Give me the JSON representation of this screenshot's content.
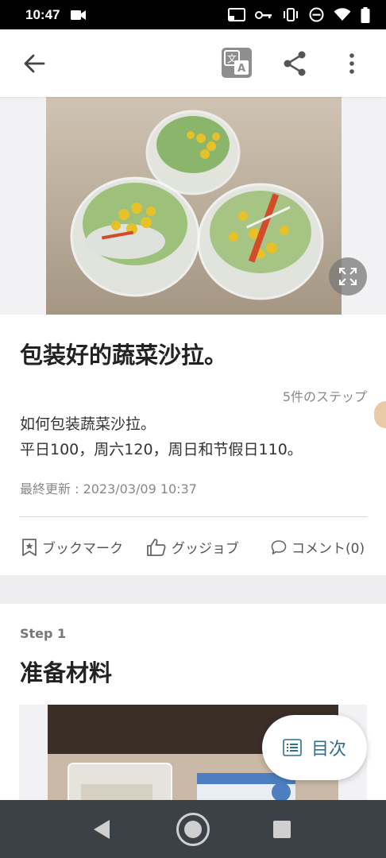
{
  "status": {
    "time": "10:47"
  },
  "recipe": {
    "title": "包装好的蔬菜沙拉。",
    "step_count": "5件のステップ",
    "desc_line1": "如何包装蔬菜沙拉。",
    "desc_line2": "平日100，周六120，周日和节假日110。",
    "updated": "最終更新 : 2023/03/09 10:37"
  },
  "actions": {
    "bookmark": "ブックマーク",
    "good_job": "グッジョブ",
    "comment": "コメント(0)"
  },
  "step1": {
    "label": "Step 1",
    "title": "准备材料"
  },
  "toc": {
    "label": "目次"
  },
  "icons": [
    "back-arrow-icon",
    "translate-icon",
    "share-icon",
    "more-vert-icon",
    "expand-icon",
    "bookmark-icon",
    "thumbs-up-icon",
    "comment-icon",
    "list-icon"
  ],
  "colors": {
    "accent": "#2e6f8c",
    "nav_bar": "#3b4147"
  }
}
